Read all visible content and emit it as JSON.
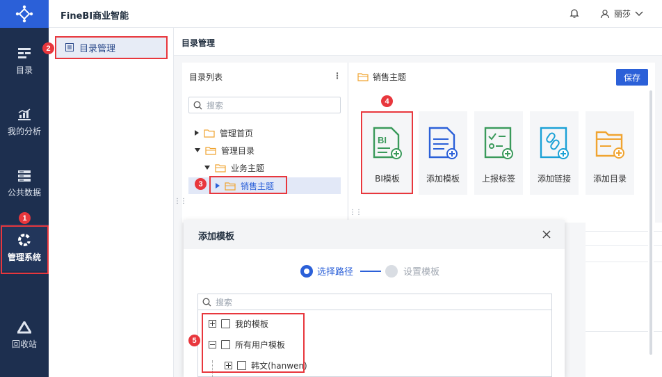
{
  "app": {
    "title": "FineBI商业智能"
  },
  "user": {
    "name": "丽莎"
  },
  "leftnav": {
    "items": [
      {
        "label": "目录"
      },
      {
        "label": "我的分析"
      },
      {
        "label": "公共数据"
      },
      {
        "label": "管理系统"
      },
      {
        "label": "回收站"
      }
    ]
  },
  "sidebar2": {
    "item": "目录管理"
  },
  "main": {
    "title": "目录管理"
  },
  "dirlist": {
    "title": "目录列表",
    "more": "⋮",
    "search_placeholder": "搜索",
    "nodes": [
      {
        "label": "管理首页"
      },
      {
        "label": "管理目录"
      },
      {
        "label": "业务主题"
      },
      {
        "label": "销售主题"
      }
    ]
  },
  "rightpanel": {
    "title": "销售主题",
    "save": "保存",
    "cards": [
      {
        "label": "BI模板",
        "icon": "bi-template-icon",
        "color": "#3a9a5b"
      },
      {
        "label": "添加模板",
        "icon": "add-template-icon",
        "color": "#2b60d8"
      },
      {
        "label": "上报标签",
        "icon": "report-tag-icon",
        "color": "#3a9a5b"
      },
      {
        "label": "添加链接",
        "icon": "add-link-icon",
        "color": "#1aa1d6"
      },
      {
        "label": "添加目录",
        "icon": "add-folder-icon",
        "color": "#f0a431"
      }
    ]
  },
  "dialog": {
    "title": "添加模板",
    "step1": "选择路径",
    "step2": "设置模板",
    "search_placeholder": "搜索",
    "tree": [
      {
        "label": "我的模板"
      },
      {
        "label": "所有用户模板"
      },
      {
        "label": "韩文(hanwen)"
      }
    ]
  },
  "annotations": [
    "1",
    "2",
    "3",
    "4",
    "5"
  ],
  "colors": {
    "nav_bg": "#1d2f4f",
    "accent": "#2b60d8",
    "annotation": "#e8373d"
  }
}
